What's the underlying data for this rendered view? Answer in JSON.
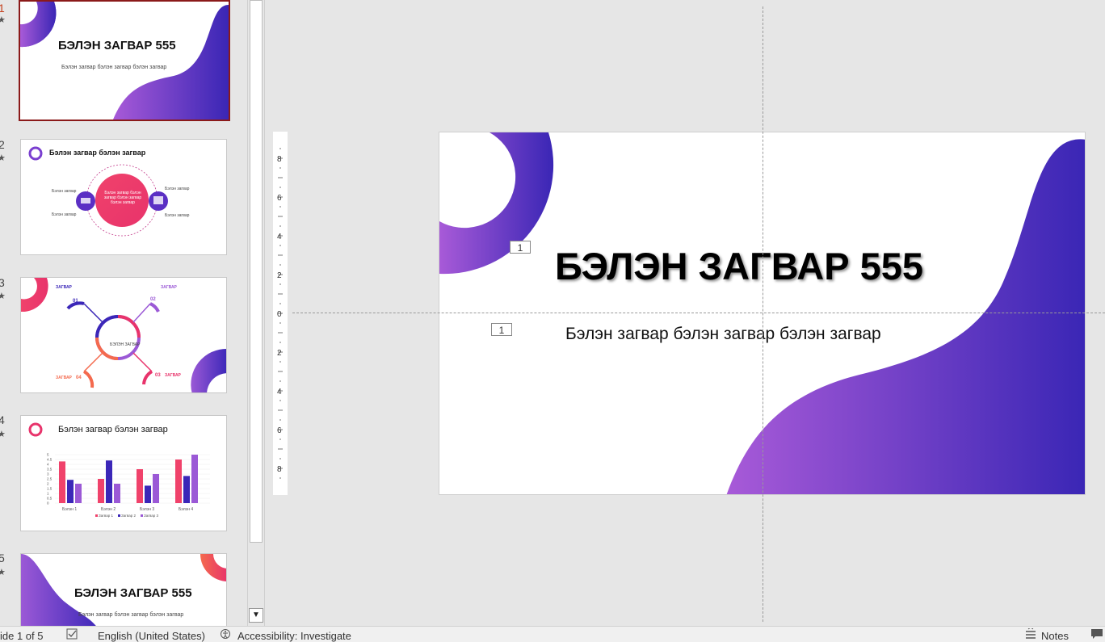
{
  "thumbnails": [
    {
      "number": "1",
      "title": "БЭЛЭН ЗАГВАР 555",
      "subtitle": "Бэлэн загвар бэлэн загвар бэлэн загвар"
    },
    {
      "number": "2",
      "title": "Бэлэн загвар бэлэн загвар",
      "center": "Бэлэн загвар бэлэн загвар бэлэн загвар бэлэн загвар",
      "labels": [
        "Бэлэн загвар",
        "Бэлэн загвар",
        "Бэлэн загвар",
        "Бэлэн загвар"
      ]
    },
    {
      "number": "3",
      "center": "БЭЛЭН ЗАГВАР",
      "items": [
        {
          "label": "ЗАГВАР",
          "num": "01"
        },
        {
          "label": "ЗАГВАР",
          "num": "02"
        },
        {
          "label": "ЗАГВАР",
          "num": "03"
        },
        {
          "label": "ЗАГВАР",
          "num": "04"
        }
      ]
    },
    {
      "number": "4",
      "title": "Бэлэн загвар бэлэн загвар",
      "chart_data": {
        "type": "bar",
        "categories": [
          "Бэлэн 1",
          "Бэлэн 2",
          "Бэлэн 3",
          "Бэлэн 4"
        ],
        "series": [
          {
            "name": "Загвар 1",
            "values": [
              4.3,
              2.5,
              3.5,
              4.5
            ]
          },
          {
            "name": "Загвар 2",
            "values": [
              2.4,
              4.4,
              1.8,
              2.8
            ]
          },
          {
            "name": "Загвар 3",
            "values": [
              2.0,
              2.0,
              3.0,
              5.0
            ]
          }
        ],
        "yticks": [
          "5",
          "4.5",
          "4",
          "3.5",
          "3",
          "2.5",
          "2",
          "1.5",
          "1",
          "0.5",
          "0"
        ],
        "ylim": [
          0,
          5
        ]
      }
    },
    {
      "number": "5",
      "title": "БЭЛЭН ЗАГВАР 555",
      "subtitle": "Бэлэн загвар бэлэн загвар бэлэн загвар"
    }
  ],
  "slide": {
    "title": "БЭЛЭН ЗАГВАР 555",
    "subtitle": "Бэлэн загвар бэлэн загвар бэлэн загвар",
    "placeholder_tag": "1"
  },
  "status": {
    "slide_info": "ide 1 of 5",
    "language": "English (United States)",
    "accessibility": "Accessibility: Investigate",
    "notes": "Notes"
  },
  "colors": {
    "purple": "#9b59d6",
    "indigo": "#3b27b8",
    "pink": "#f0426b",
    "orange": "#f46a4e"
  }
}
